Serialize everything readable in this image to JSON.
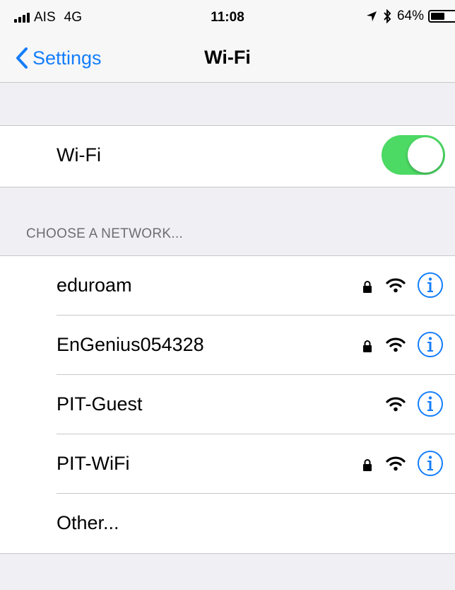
{
  "status_bar": {
    "carrier": "AIS",
    "network": "4G",
    "time": "11:08",
    "battery": "64%",
    "battery_level": 0.64,
    "icons": [
      "signal-icon",
      "location-arrow-icon",
      "bluetooth-icon",
      "battery-icon"
    ]
  },
  "nav": {
    "back_label": "Settings",
    "title": "Wi-Fi"
  },
  "wifi_toggle": {
    "label": "Wi-Fi",
    "on": true
  },
  "section_header": "CHOOSE A NETWORK...",
  "networks": [
    {
      "name": "eduroam",
      "locked": true
    },
    {
      "name": "EnGenius054328",
      "locked": true
    },
    {
      "name": "PIT-Guest",
      "locked": false
    },
    {
      "name": "PIT-WiFi",
      "locked": true
    },
    {
      "name": "Other...",
      "other": true
    }
  ],
  "colors": {
    "accent": "#147efb",
    "toggle_on": "#4cd964",
    "background": "#efeff4"
  }
}
